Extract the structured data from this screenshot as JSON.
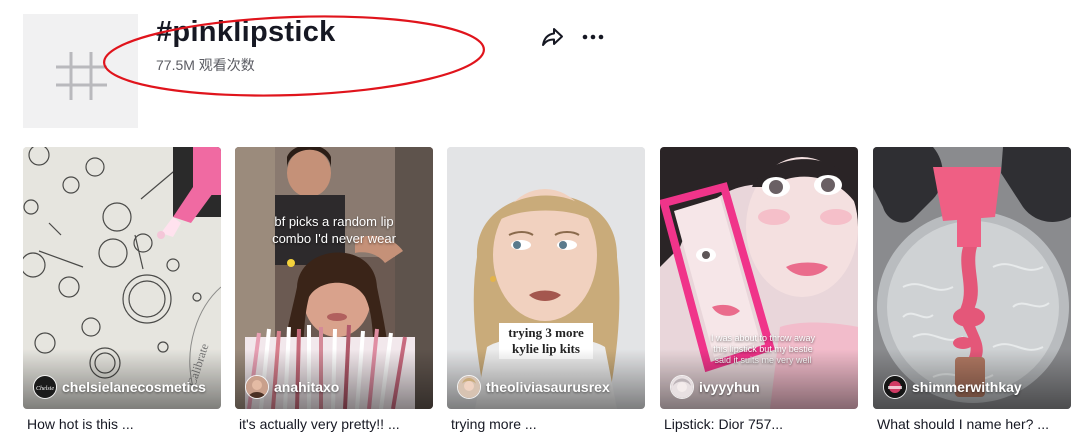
{
  "header": {
    "title": "#pinklipstick",
    "views": "77.5M 观看次数",
    "hash_icon": "hashtag-icon",
    "share_icon": "share-icon",
    "more_icon": "more-horizontal-icon",
    "annotation_color": "#e0141c"
  },
  "videos": [
    {
      "author": "chelsielanecosmetics",
      "caption": "How hot is this ...",
      "avatar_text": "Chelsie",
      "overlay": ""
    },
    {
      "author": "anahitaxo",
      "caption": "it's actually very pretty!! ...",
      "overlay": "bf picks a random lip combo I'd never wear"
    },
    {
      "author": "theoliviasaurusrex",
      "caption": "trying more ...",
      "overlay": "trying 3 more kylie lip kits"
    },
    {
      "author": "ivyyyhun",
      "caption": "Lipstick: Dior 757...",
      "overlay": "I was about to throw away this lipstick but my bestie said it suits me very well"
    },
    {
      "author": "shimmerwithkay",
      "caption": "What should I name her? ...",
      "overlay": ""
    }
  ]
}
